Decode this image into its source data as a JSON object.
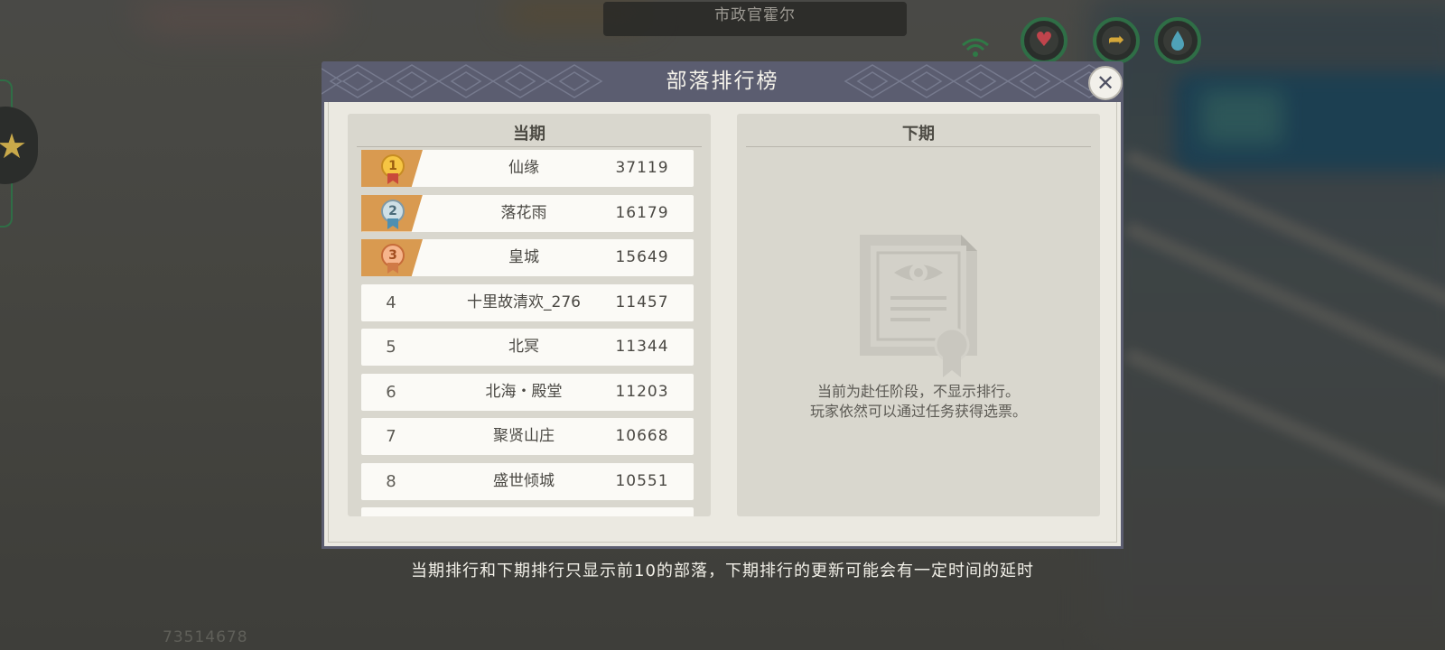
{
  "hud": {
    "npc_name": "市政官霍尔",
    "uid": "73514678",
    "icons": [
      "heart-icon",
      "arrow-icon",
      "water-drop-icon",
      "wifi-icon",
      "star-icon"
    ]
  },
  "modal": {
    "title": "部落排行榜",
    "current": {
      "title": "当期",
      "rows": [
        {
          "rank": "1",
          "name": "仙缘",
          "score": "37119",
          "medal": "gold"
        },
        {
          "rank": "2",
          "name": "落花雨",
          "score": "16179",
          "medal": "silver"
        },
        {
          "rank": "3",
          "name": "皇城",
          "score": "15649",
          "medal": "bronze"
        },
        {
          "rank": "4",
          "name": "十里故清欢_276",
          "score": "11457"
        },
        {
          "rank": "5",
          "name": "北冥",
          "score": "11344"
        },
        {
          "rank": "6",
          "name": "北海・殿堂",
          "score": "11203"
        },
        {
          "rank": "7",
          "name": "聚贤山庄",
          "score": "10668"
        },
        {
          "rank": "8",
          "name": "盛世倾城",
          "score": "10551"
        }
      ]
    },
    "next": {
      "title": "下期",
      "message_line1": "当前为赴任阶段，不显示排行。",
      "message_line2": "玩家依然可以通过任务获得选票。"
    }
  },
  "footer_note": "当期排行和下期排行只显示前10的部落，下期排行的更新可能会有一定时间的延时",
  "colors": {
    "header": "#5b5d70",
    "panel": "#ebe9e1",
    "column": "#d9d7ce",
    "medal_tab": "#d99a50",
    "hud_ring": "#2f6e46"
  }
}
